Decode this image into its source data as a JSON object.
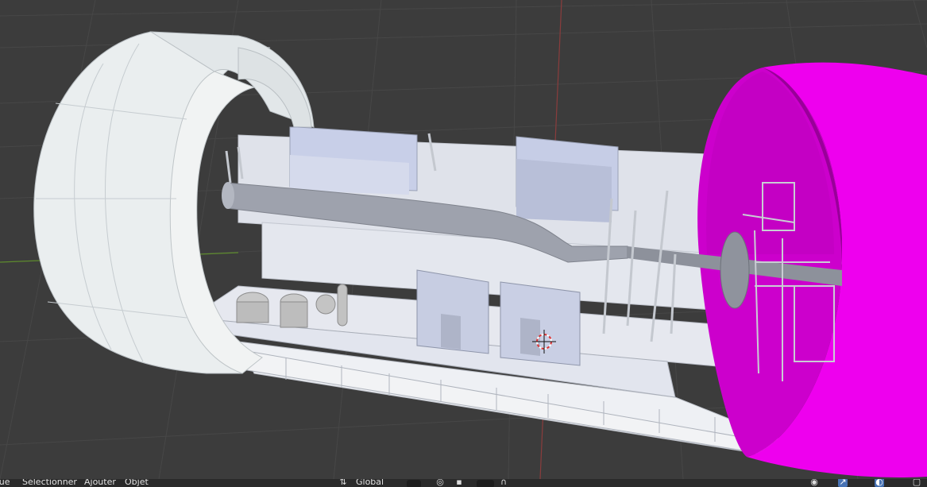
{
  "viewport": {
    "grid_color": "#474747",
    "x_axis_color": "#7a3a3a",
    "y_axis_color": "#5d8a2d",
    "background": "#3c3c3c"
  },
  "header": {
    "menu": {
      "view_label": "Vue",
      "select_label": "Sélectionner",
      "add_label": "Ajouter",
      "object_label": "Objet"
    },
    "transform_orientation": "Global",
    "icons": {
      "orientation": "transform-orientation-icon",
      "pivot": "pivot-point-icon",
      "snap": "snap-icon",
      "snap_target": "snap-increment-icon",
      "proportional": "proportional-editing-icon",
      "falloff": "falloff-icon",
      "visibility": "eye-icon",
      "gizmo": "gizmo-icon",
      "overlays": "overlays-icon",
      "xray": "xray-icon"
    }
  },
  "scene": {
    "objects": [
      "tunnel-ring-left",
      "tunnel-ring-right",
      "tunnel-platform",
      "duct-pipe",
      "equipment-cabinet",
      "barrel",
      "ladder",
      "cage-ladder",
      "3d-cursor"
    ],
    "selected_color": "#ee00ee"
  }
}
